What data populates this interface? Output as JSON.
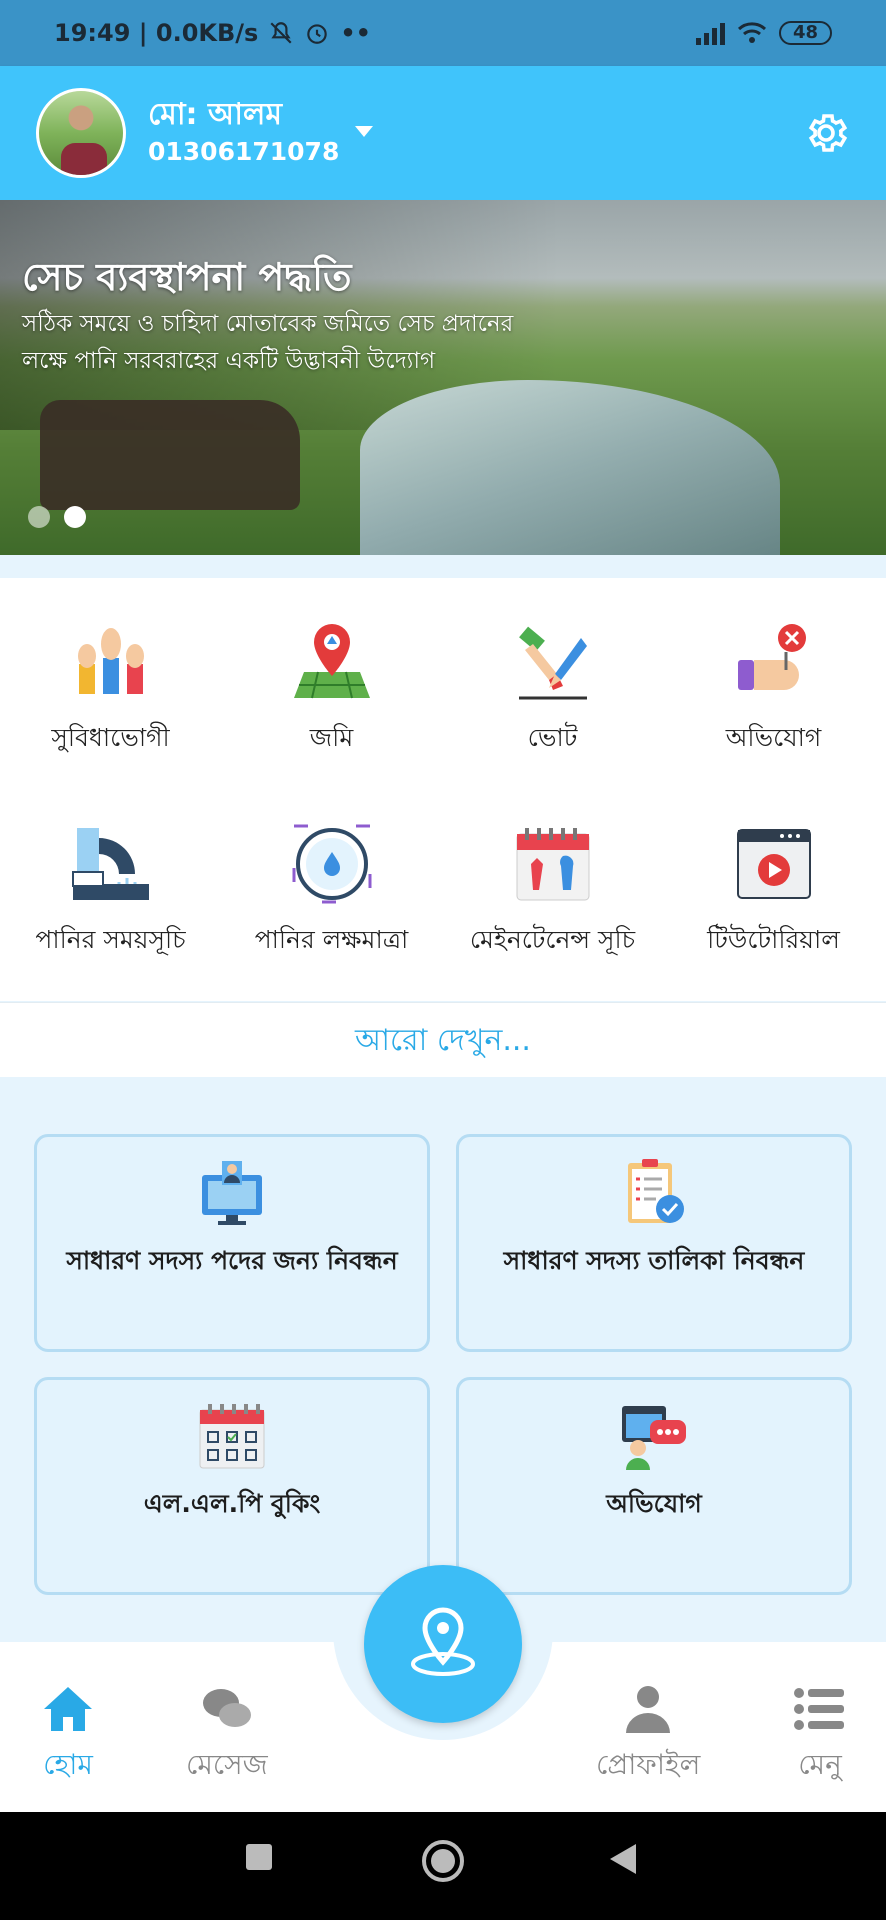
{
  "status_bar": {
    "time_speed": "19:49 | 0.0KB/s",
    "more": "••",
    "battery": "48"
  },
  "header": {
    "user_name": "মো: আলম",
    "user_phone": "01306171078",
    "icons": [
      "avatar",
      "chevron-down-icon",
      "gear-icon"
    ]
  },
  "banner": {
    "title": "সেচ ব্যবস্থাপনা পদ্ধতি",
    "subtitle": "সঠিক সময়ে ও চাহিদা মোতাবেক জমিতে সেচ প্রদানের লক্ষে পানি সরবরাহের একটি উদ্ভাবনী উদ্যোগ",
    "slides_total": 2,
    "active_slide": 2
  },
  "services": [
    {
      "label": "সুবিধাভোগী",
      "icon": "raised-hands-icon"
    },
    {
      "label": "জমি",
      "icon": "land-pin-icon"
    },
    {
      "label": "ভোট",
      "icon": "vote-icon"
    },
    {
      "label": "অভিযোগ",
      "icon": "complaint-icon"
    },
    {
      "label": "পানির সময়সূচি",
      "icon": "water-pipe-icon"
    },
    {
      "label": "পানির লক্ষমাত্রা",
      "icon": "water-target-icon"
    },
    {
      "label": "মেইনটেনেন্স সূচি",
      "icon": "maintenance-calendar-icon"
    },
    {
      "label": "টিউটোরিয়াল",
      "icon": "video-tutorial-icon"
    }
  ],
  "more_link": "আরো দেখুন...",
  "cards": [
    {
      "label": "সাধারণ সদস্য পদের জন্য নিবন্ধন",
      "icon": "monitor-user-icon"
    },
    {
      "label": "সাধারণ সদস্য তালিকা নিবন্ধন",
      "icon": "checklist-icon"
    },
    {
      "label": "এল.এল.পি বুকিং",
      "icon": "calendar-icon"
    },
    {
      "label": "অভিযোগ",
      "icon": "chat-support-icon"
    }
  ],
  "bottom_nav": {
    "home": "হোম",
    "message": "মেসেজ",
    "profile": "প্রোফাইল",
    "menu": "মেনু",
    "active": "home",
    "center_icon": "location-pin-icon"
  },
  "colors": {
    "header": "#40c4fb",
    "accent": "#29a9e6",
    "status_bar": "#3a93c7",
    "card_bg": "#e3f3fd",
    "card_border": "#b5dcf3"
  }
}
